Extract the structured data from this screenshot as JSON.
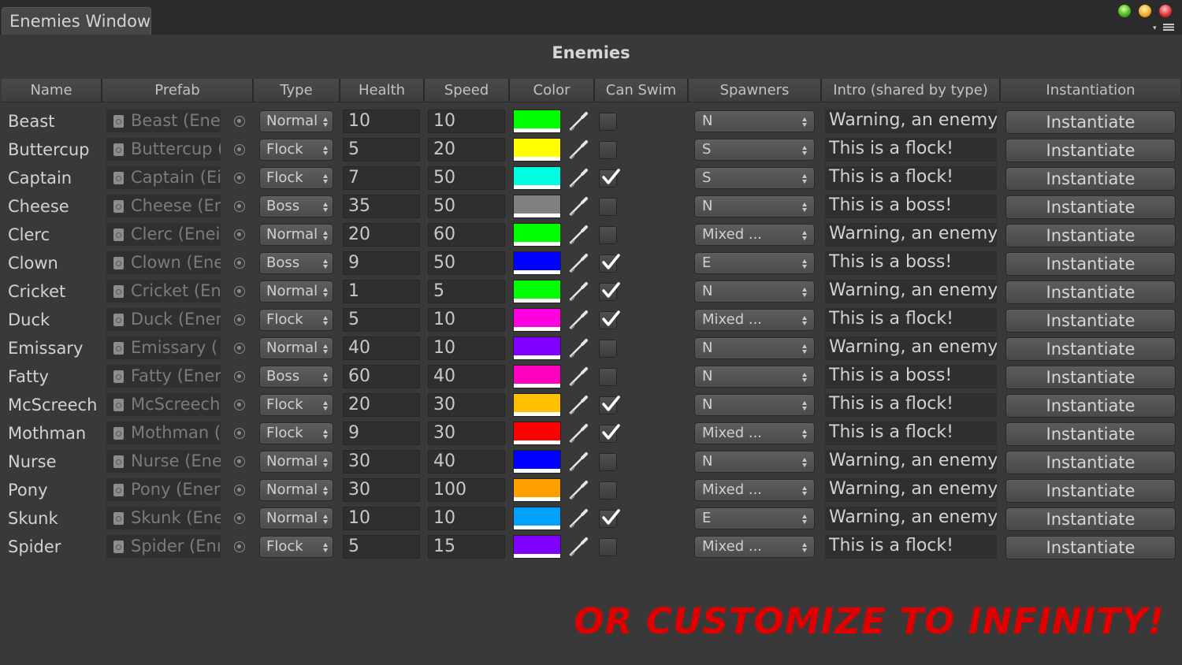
{
  "window": {
    "tab_title": "Enemies Window"
  },
  "heading": "Enemies",
  "columns": [
    "Name",
    "Prefab",
    "Type",
    "Health",
    "Speed",
    "Color",
    "Can Swim",
    "Spawners",
    "Intro (shared by type)",
    "Instantiation"
  ],
  "rows": [
    {
      "name": "Beast",
      "prefab": "Beast (Enei",
      "type": "Normal",
      "health": "10",
      "speed": "10",
      "color": "#00ff00",
      "can_swim": false,
      "spawners": "N",
      "intro": "Warning, an enemy!",
      "button": "Instantiate"
    },
    {
      "name": "Buttercup",
      "prefab": "Buttercup (",
      "type": "Flock",
      "health": "5",
      "speed": "20",
      "color": "#ffff00",
      "can_swim": false,
      "spawners": "S",
      "intro": "This is a flock!",
      "button": "Instantiate"
    },
    {
      "name": "Captain",
      "prefab": "Captain (Ei",
      "type": "Flock",
      "health": "7",
      "speed": "50",
      "color": "#00ffe0",
      "can_swim": true,
      "spawners": "S",
      "intro": "This is a flock!",
      "button": "Instantiate"
    },
    {
      "name": "Cheese",
      "prefab": "Cheese (Er",
      "type": "Boss",
      "health": "35",
      "speed": "50",
      "color": "#808080",
      "can_swim": false,
      "spawners": "N",
      "intro": "This is a boss!",
      "button": "Instantiate"
    },
    {
      "name": "Clerc",
      "prefab": "Clerc (Enei",
      "type": "Normal",
      "health": "20",
      "speed": "60",
      "color": "#00ff00",
      "can_swim": false,
      "spawners": "Mixed ...",
      "intro": "Warning, an enemy!",
      "button": "Instantiate"
    },
    {
      "name": "Clown",
      "prefab": "Clown (Ene",
      "type": "Boss",
      "health": "9",
      "speed": "50",
      "color": "#0000ff",
      "can_swim": true,
      "spawners": "E",
      "intro": "This is a boss!",
      "button": "Instantiate"
    },
    {
      "name": "Cricket",
      "prefab": "Cricket (En",
      "type": "Normal",
      "health": "1",
      "speed": "5",
      "color": "#00ff00",
      "can_swim": true,
      "spawners": "N",
      "intro": "Warning, an enemy!",
      "button": "Instantiate"
    },
    {
      "name": "Duck",
      "prefab": "Duck (Ener",
      "type": "Flock",
      "health": "5",
      "speed": "10",
      "color": "#ff00e0",
      "can_swim": true,
      "spawners": "Mixed ...",
      "intro": "This is a flock!",
      "button": "Instantiate"
    },
    {
      "name": "Emissary",
      "prefab": "Emissary (",
      "type": "Normal",
      "health": "40",
      "speed": "10",
      "color": "#8000ff",
      "can_swim": false,
      "spawners": "N",
      "intro": "Warning, an enemy!",
      "button": "Instantiate"
    },
    {
      "name": "Fatty",
      "prefab": "Fatty (Ener",
      "type": "Boss",
      "health": "60",
      "speed": "40",
      "color": "#ff00c0",
      "can_swim": false,
      "spawners": "N",
      "intro": "This is a boss!",
      "button": "Instantiate"
    },
    {
      "name": "McScreech",
      "prefab": "McScreech",
      "type": "Flock",
      "health": "20",
      "speed": "30",
      "color": "#ffc000",
      "can_swim": true,
      "spawners": "N",
      "intro": "This is a flock!",
      "button": "Instantiate"
    },
    {
      "name": "Mothman",
      "prefab": "Mothman (",
      "type": "Flock",
      "health": "9",
      "speed": "30",
      "color": "#ff0000",
      "can_swim": true,
      "spawners": "Mixed ...",
      "intro": "This is a flock!",
      "button": "Instantiate"
    },
    {
      "name": "Nurse",
      "prefab": "Nurse (Ene",
      "type": "Normal",
      "health": "30",
      "speed": "40",
      "color": "#0000ff",
      "can_swim": false,
      "spawners": "N",
      "intro": "Warning, an enemy!",
      "button": "Instantiate"
    },
    {
      "name": "Pony",
      "prefab": "Pony (Ener",
      "type": "Normal",
      "health": "30",
      "speed": "100",
      "color": "#ffa000",
      "can_swim": false,
      "spawners": "Mixed ...",
      "intro": "Warning, an enemy!",
      "button": "Instantiate"
    },
    {
      "name": "Skunk",
      "prefab": "Skunk (Ene",
      "type": "Normal",
      "health": "10",
      "speed": "10",
      "color": "#00a0ff",
      "can_swim": true,
      "spawners": "E",
      "intro": "Warning, an enemy!",
      "button": "Instantiate"
    },
    {
      "name": "Spider",
      "prefab": "Spider (Enı",
      "type": "Flock",
      "health": "5",
      "speed": "15",
      "color": "#8000ff",
      "can_swim": false,
      "spawners": "Mixed ...",
      "intro": "This is a flock!",
      "button": "Instantiate"
    }
  ],
  "promo": "OR CUSTOMIZE TO INFINITY!"
}
